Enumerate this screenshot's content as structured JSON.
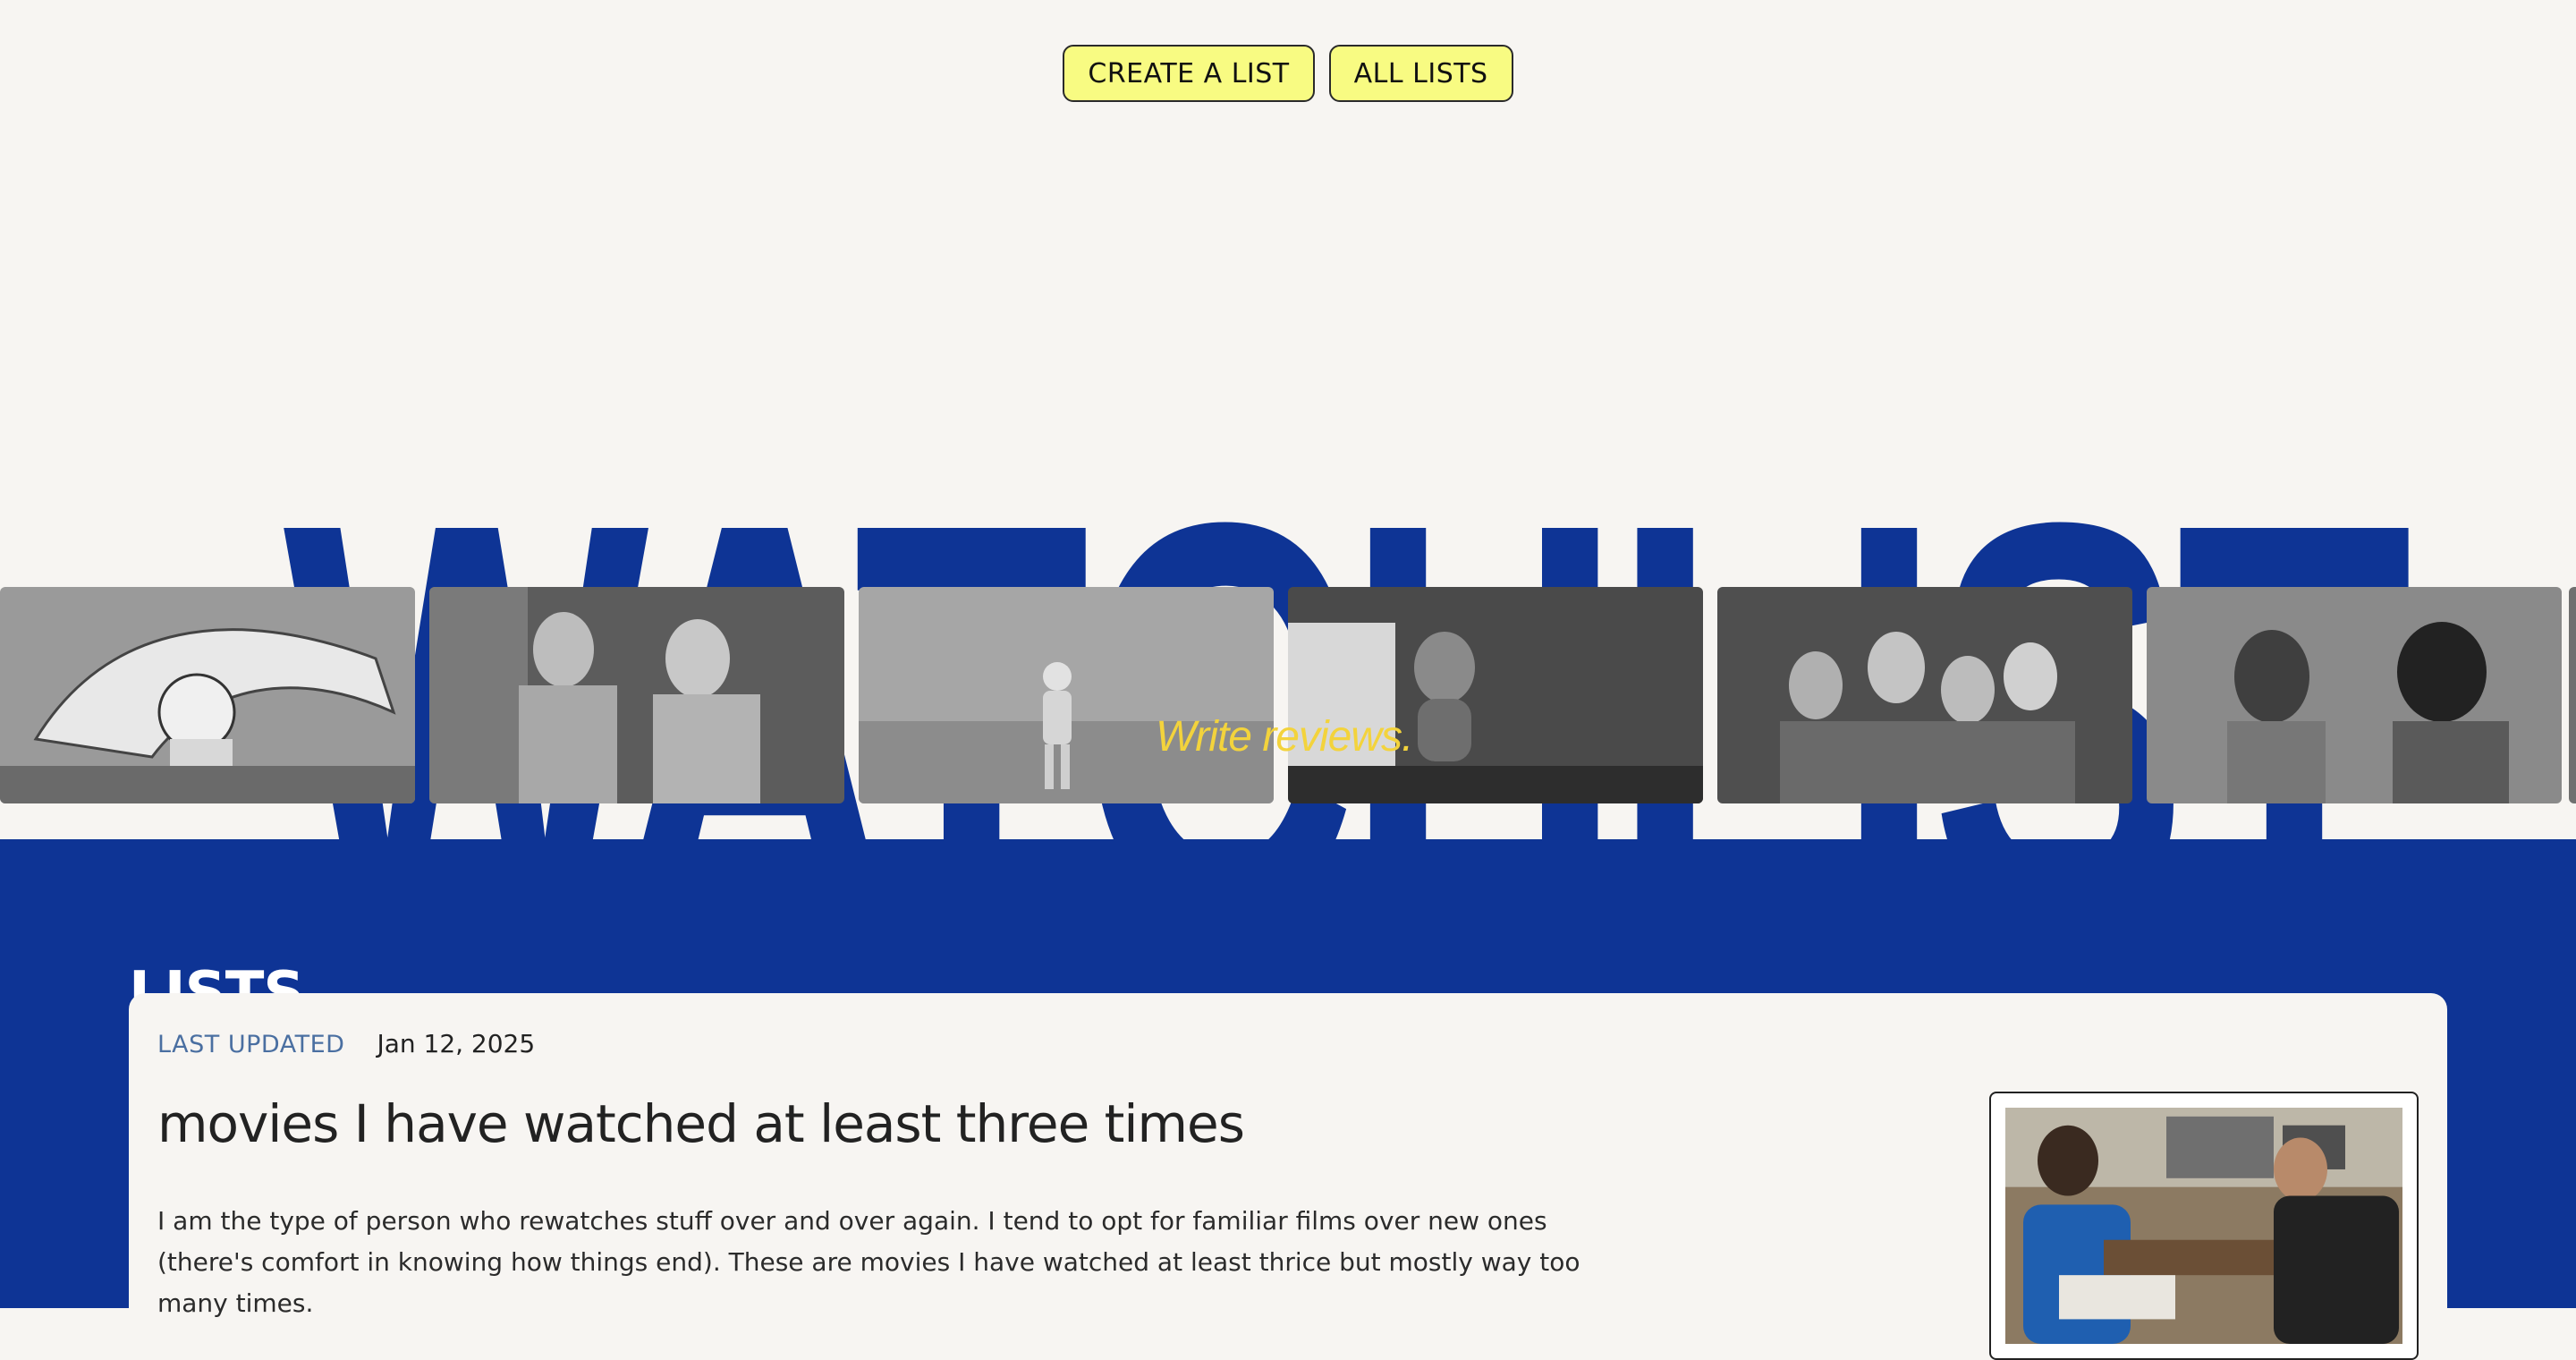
{
  "nav": {
    "create_list": "CREATE A LIST",
    "all_lists": "ALL LISTS"
  },
  "hero": {
    "title": "WATCHLIST",
    "overlay_text": "Write reviews."
  },
  "filmstrip": {
    "count": 6
  },
  "lists_section": {
    "heading": "LISTS",
    "cards": [
      {
        "last_updated_label": "LAST UPDATED",
        "last_updated_date": "Jan 12, 2025",
        "title": "movies I have watched at least three times",
        "description": "I am the type of person who rewatches stuff over and over again.  I tend to opt for familiar films over new ones (there's comfort in knowing how things end). These are movies  I have watched at least thrice but mostly way too many times."
      }
    ]
  },
  "colors": {
    "brand_blue": "#0e3495",
    "button_yellow": "#f8fb82",
    "background": "#f7f5f2",
    "overlay_yellow": "#f3d33c",
    "label_blue": "#4a6fa1"
  }
}
